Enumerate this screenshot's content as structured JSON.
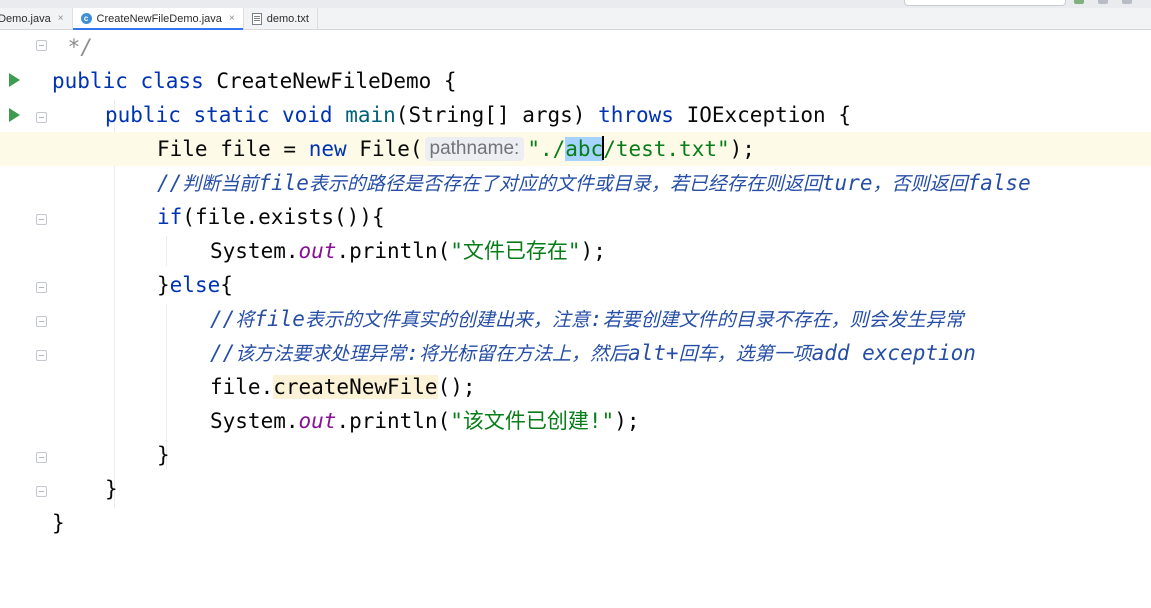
{
  "tabs": [
    {
      "label": "eDemo.java",
      "icon": "java-file-icon",
      "active": false
    },
    {
      "label": "CreateNewFileDemo.java",
      "icon": "java-file-icon",
      "active": true
    },
    {
      "label": "demo.txt",
      "icon": "text-file-icon",
      "active": false
    }
  ],
  "tab_close_glyph": "×",
  "java_icon_letter": "c",
  "colors": {
    "keyword": "#0033b3",
    "string": "#067d17",
    "static_field": "#871094",
    "comment": "#264ea7",
    "selection": "#a6d2ff",
    "current_line": "#fdfbe8",
    "run_icon": "#3f9b4f"
  },
  "code": {
    "l1": {
      "text": " */"
    },
    "l2": {
      "kw1": "public class",
      "name": " CreateNewFileDemo {"
    },
    "l3": {
      "kw1": "public static void",
      "method": " main",
      "args": "(String[] args) ",
      "kw2": "throws",
      "rest": " IOException {"
    },
    "l4": {
      "a": "File file = ",
      "kw": "new",
      "b": " File(",
      "hint": "pathname:",
      "s1": "\"./",
      "sel": "abc",
      "s2": "/test.txt\"",
      "end": ");"
    },
    "l5": {
      "p1": "//",
      "c1": "判断当前",
      "p2": "file",
      "c2": "表示的路径是否存在了对应的文件或目录，若已经存在则返回",
      "p3": "ture",
      "c3": "，否则返回",
      "p4": "false"
    },
    "l6": {
      "kw": "if",
      "rest": "(file.exists()){"
    },
    "l7": {
      "a": "System.",
      "fld": "out",
      "b": ".println(",
      "str": "\"文件已存在\"",
      "end": ");"
    },
    "l8": {
      "a": "}",
      "kw": "else",
      "b": "{"
    },
    "l9": {
      "p1": "//",
      "c1": "将",
      "p2": "file",
      "c2": "表示的文件真实的创建出来，注意",
      "p3": ":",
      "c3": "若要创建文件的目录不存在，则会发生异常"
    },
    "l10": {
      "p1": "//",
      "c1": "该方法要求处理异常",
      "p2": ":",
      "c2": "将光标留在方法上，然后",
      "p3": "alt+",
      "c3": "回车，选第一项",
      "p4": "add exception"
    },
    "l11": {
      "a": "file.",
      "method": "createNewFile",
      "b": "();"
    },
    "l12": {
      "a": "System.",
      "fld": "out",
      "b": ".println(",
      "str": "\"该文件已创建!\"",
      "end": ");"
    },
    "l13": {
      "text": "}"
    },
    "l14": {
      "text": "}"
    },
    "l15": {
      "text": "}"
    }
  }
}
